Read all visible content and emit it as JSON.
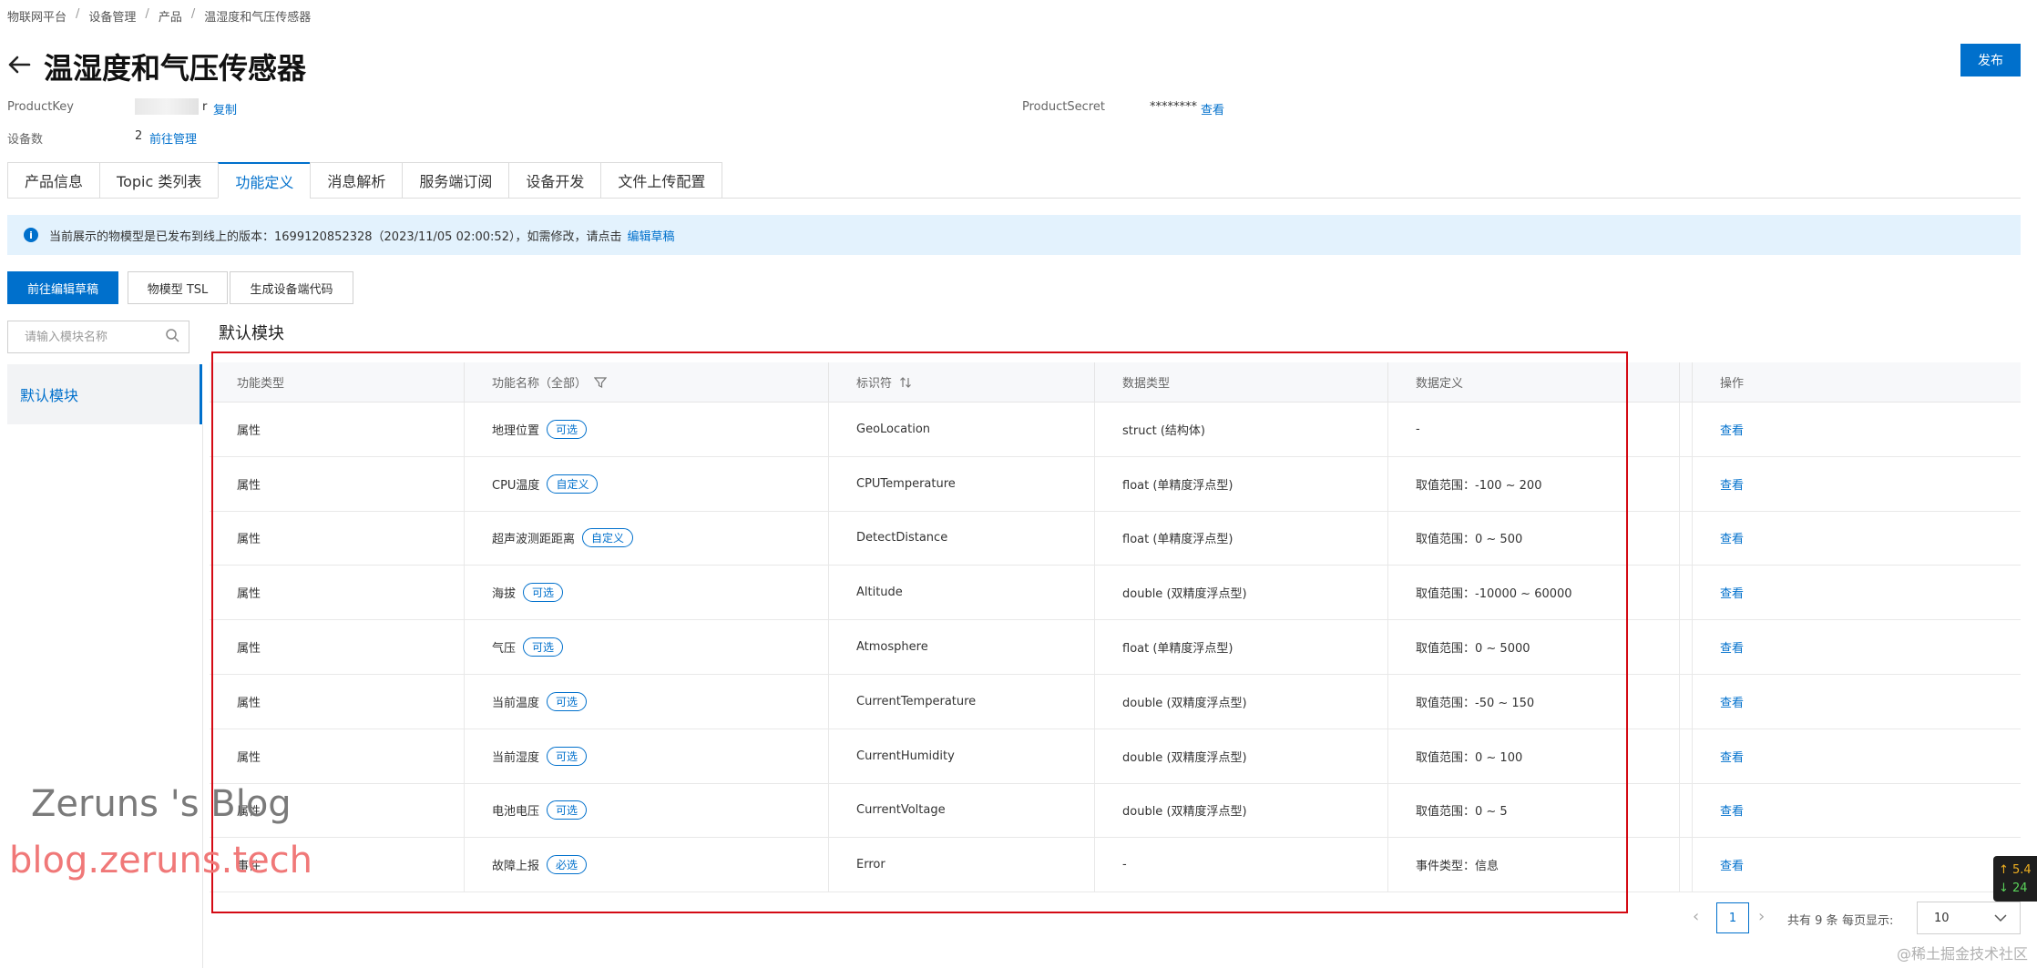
{
  "breadcrumb": [
    "物联网平台",
    "设备管理",
    "产品",
    "温湿度和气压传感器"
  ],
  "breadcrumb_sep": "/",
  "page_title": "温湿度和气压传感器",
  "publish_label": "发布",
  "meta": {
    "product_key_label": "ProductKey",
    "product_key_suffix": "r",
    "copy_label": "复制",
    "product_secret_label": "ProductSecret",
    "product_secret_value": "********",
    "view_label": "查看",
    "device_count_label": "设备数",
    "device_count_value": "2",
    "manage_label": "前往管理"
  },
  "tabs": [
    "产品信息",
    "Topic 类列表",
    "功能定义",
    "消息解析",
    "服务端订阅",
    "设备开发",
    "文件上传配置"
  ],
  "active_tab": "功能定义",
  "notice": {
    "text": "当前展示的物模型是已发布到线上的版本：1699120852328（2023/11/05 02:00:52），如需修改，请点击",
    "link": "编辑草稿"
  },
  "actions": {
    "edit_draft": "前往编辑草稿",
    "tsl": "物模型 TSL",
    "gen_code": "生成设备端代码"
  },
  "sidebar": {
    "search_placeholder": "请输入模块名称",
    "items": [
      "默认模块"
    ]
  },
  "module_title": "默认模块",
  "table": {
    "headers": [
      "功能类型",
      "功能名称（全部）",
      "标识符",
      "数据类型",
      "数据定义",
      "",
      "操作"
    ],
    "rows": [
      {
        "type": "属性",
        "name": "地理位置",
        "tag": "可选",
        "id": "GeoLocation",
        "dtype": "struct (结构体)",
        "def": "-",
        "op": "查看"
      },
      {
        "type": "属性",
        "name": "CPU温度",
        "tag": "自定义",
        "id": "CPUTemperature",
        "dtype": "float (单精度浮点型)",
        "def": "取值范围：-100 ~ 200",
        "op": "查看"
      },
      {
        "type": "属性",
        "name": "超声波测距距离",
        "tag": "自定义",
        "id": "DetectDistance",
        "dtype": "float (单精度浮点型)",
        "def": "取值范围：0 ~ 500",
        "op": "查看"
      },
      {
        "type": "属性",
        "name": "海拔",
        "tag": "可选",
        "id": "Altitude",
        "dtype": "double (双精度浮点型)",
        "def": "取值范围：-10000 ~ 60000",
        "op": "查看"
      },
      {
        "type": "属性",
        "name": "气压",
        "tag": "可选",
        "id": "Atmosphere",
        "dtype": "float (单精度浮点型)",
        "def": "取值范围：0 ~ 5000",
        "op": "查看"
      },
      {
        "type": "属性",
        "name": "当前温度",
        "tag": "可选",
        "id": "CurrentTemperature",
        "dtype": "double (双精度浮点型)",
        "def": "取值范围：-50 ~ 150",
        "op": "查看"
      },
      {
        "type": "属性",
        "name": "当前湿度",
        "tag": "可选",
        "id": "CurrentHumidity",
        "dtype": "double (双精度浮点型)",
        "def": "取值范围：0 ~ 100",
        "op": "查看"
      },
      {
        "type": "属性",
        "name": "电池电压",
        "tag": "可选",
        "id": "CurrentVoltage",
        "dtype": "double (双精度浮点型)",
        "def": "取值范围：0 ~ 5",
        "op": "查看"
      },
      {
        "type": "事件",
        "name": "故障上报",
        "tag": "必选",
        "id": "Error",
        "dtype": "-",
        "def": "事件类型：信息",
        "op": "查看"
      }
    ]
  },
  "pagination": {
    "current_page": "1",
    "total_text": "共有 9 条",
    "page_size_label": "每页显示:",
    "page_size": "10"
  },
  "watermark": {
    "line1": "Zeruns 's Blog",
    "line2": "blog.zeruns.tech"
  },
  "credit": "@稀土掘金技术社区",
  "netspeed": {
    "up": "↑ 5.4",
    "down": "↓ 24"
  },
  "colors": {
    "accent": "#0070cc",
    "highlight_border": "#d40a14",
    "notice_bg": "#e3f2fd"
  }
}
